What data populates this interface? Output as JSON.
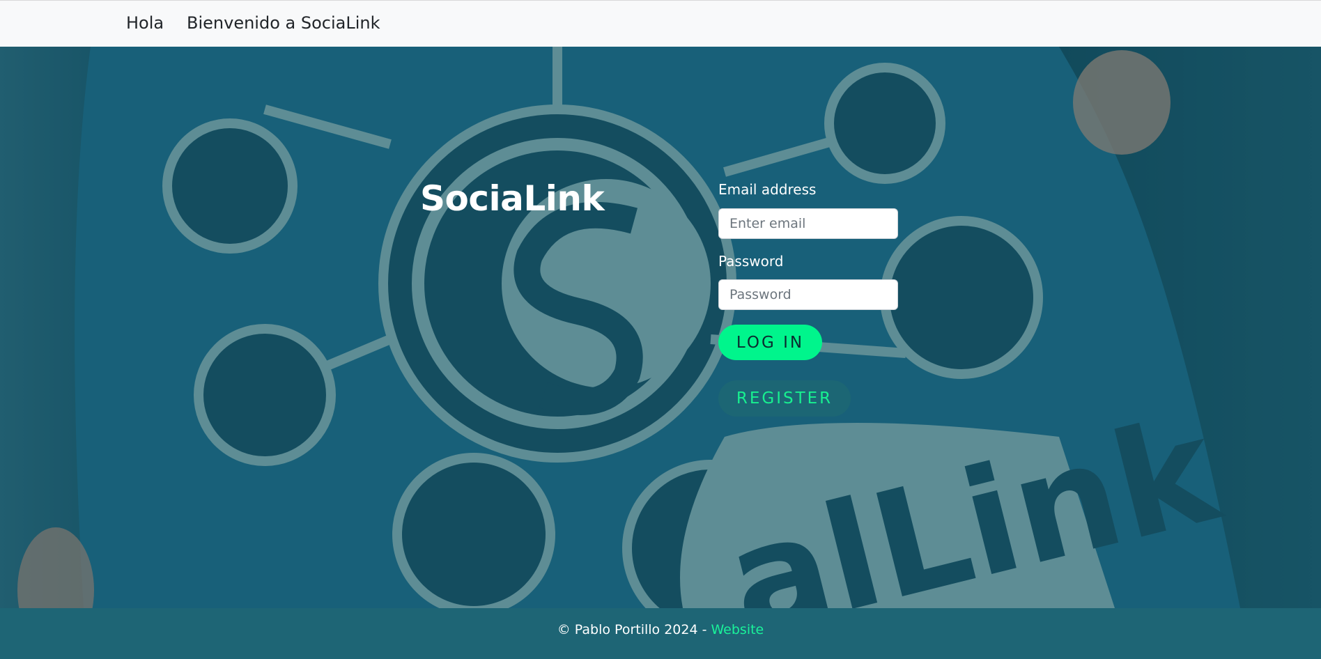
{
  "navbar": {
    "brand": "Hola",
    "link": "Bienvenido a SociaLink"
  },
  "hero": {
    "title": "SociaLink",
    "form": {
      "email_label": "Email address",
      "email_placeholder": "Enter email",
      "email_value": "",
      "password_label": "Password",
      "password_placeholder": "Password",
      "password_value": "",
      "login_label": "LOG IN",
      "register_label": "REGISTER"
    },
    "background_text": "alLink"
  },
  "footer": {
    "copyright": "© Pablo Portillo 2024 - ",
    "website_link": "Website"
  },
  "colors": {
    "navbar_bg": "#f8f9fa",
    "hero_bg": "#1d6a84",
    "login_button": "#00f58c",
    "register_button": "#1c6674",
    "register_text": "#18f090",
    "footer_bg": "#1e6575",
    "footer_link": "#1af29a"
  }
}
